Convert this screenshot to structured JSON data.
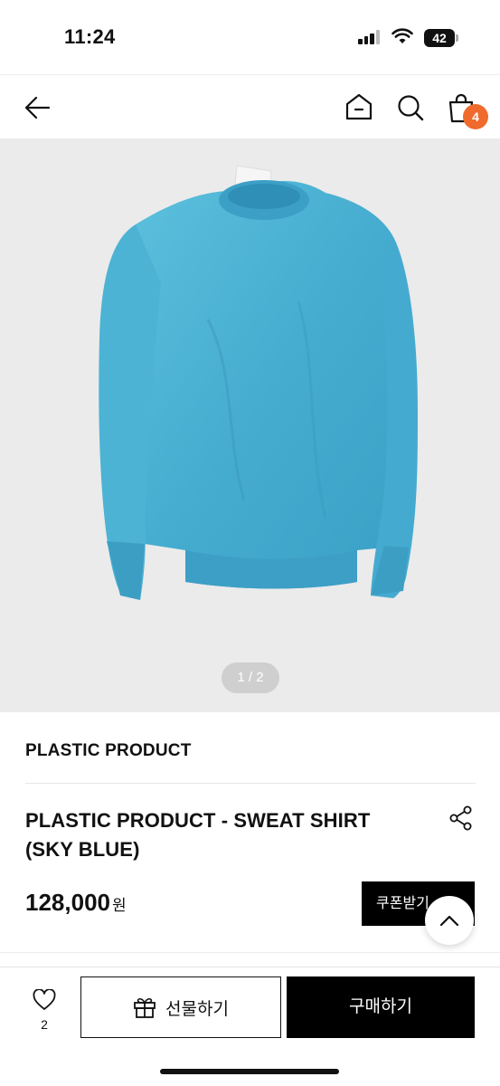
{
  "status": {
    "time": "11:24",
    "battery": "42"
  },
  "header": {
    "cart_count": "4"
  },
  "gallery": {
    "counter": "1 / 2"
  },
  "product": {
    "brand": "PLASTIC PRODUCT",
    "title": "PLASTIC PRODUCT - SWEAT SHIRT (SKY BLUE)",
    "price": "128,000",
    "currency": "원",
    "coupon_label": "쿠폰받기"
  },
  "bottom_bar": {
    "like_count": "2",
    "gift_label": "선물하기",
    "buy_label": "구매하기"
  },
  "colors": {
    "badge": "#ef6a2c",
    "sweater": "#4fb4d4",
    "primary_button": "#000000"
  },
  "icons": [
    "back-arrow-icon",
    "home-icon",
    "search-icon",
    "cart-icon",
    "share-icon",
    "chevron-up-icon",
    "heart-icon",
    "gift-icon",
    "cellular-signal-icon",
    "wifi-icon",
    "battery-icon"
  ]
}
